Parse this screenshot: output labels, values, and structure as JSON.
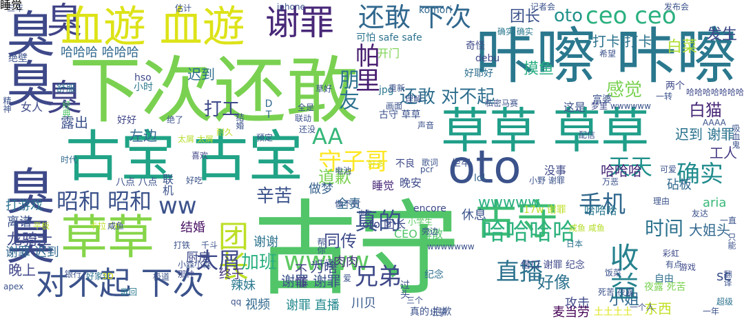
{
  "cloud": {
    "words": [
      {
        "text": "古守",
        "color": "#52c569"
      },
      {
        "text": "下次还敢",
        "color": "#7ad151"
      },
      {
        "text": "咔嚓 咔嚓",
        "color": "#2a788e"
      },
      {
        "text": "草草 草草",
        "color": "#1f9e89"
      },
      {
        "text": "古宝 古宝",
        "color": "#20a386"
      },
      {
        "text": "臭臭 臭臭",
        "color": "#3e4989"
      },
      {
        "text": "臭 臭",
        "color": "#414487"
      },
      {
        "text": "草草",
        "color": "#86d549"
      },
      {
        "text": "血遊 血遊",
        "color": "#dde318"
      },
      {
        "text": "oto",
        "color": "#3b528b"
      },
      {
        "text": "谢罪",
        "color": "#482878"
      },
      {
        "text": "对不起 下次",
        "color": "#3b528b"
      },
      {
        "text": "还敢 下次",
        "color": "#31688e"
      },
      {
        "text": "ceo ceo",
        "color": "#2ab07f"
      },
      {
        "text": "古守",
        "color": "#3dbc74"
      },
      {
        "text": "团长",
        "color": "#bddf26"
      },
      {
        "text": "收益",
        "color": "#26828e"
      },
      {
        "text": "直播",
        "color": "#2c728e"
      },
      {
        "text": "昭和 昭和",
        "color": "#3b528b"
      },
      {
        "text": "ww",
        "color": "#3b528b"
      },
      {
        "text": "守子哥",
        "color": "#fde725"
      },
      {
        "text": "太屑",
        "color": "#3e4989"
      },
      {
        "text": "手机",
        "color": "#31688e"
      },
      {
        "text": "确实",
        "color": "#228c8d"
      },
      {
        "text": "天天",
        "color": "#21918c"
      },
      {
        "text": "哈哈哈哈",
        "color": "#2db27d"
      },
      {
        "text": "wwww",
        "color": "#5ec962"
      },
      {
        "text": "兄弟",
        "color": "#3e4989"
      },
      {
        "text": "真的",
        "color": "#3b528b"
      },
      {
        "text": "AA",
        "color": "#35b779"
      },
      {
        "text": "哈哈哈 哈哈哈",
        "color": "#31688e"
      },
      {
        "text": "白猫",
        "color": "#482878"
      },
      {
        "text": "朋友",
        "color": "#2c728e"
      },
      {
        "text": "帕里",
        "color": "#481f70"
      },
      {
        "text": "还敢 对不起",
        "color": "#2e6e8e"
      },
      {
        "text": "感觉",
        "color": "#7ad151"
      },
      {
        "text": "打工",
        "color": "#3e4989"
      },
      {
        "text": "辛苦",
        "color": "#3b528b"
      },
      {
        "text": "道歉",
        "color": "#7ad151"
      },
      {
        "text": "时间",
        "color": "#2c728e"
      },
      {
        "text": "好像",
        "color": "#2c728e"
      },
      {
        "text": "同传",
        "color": "#3e4989"
      },
      {
        "text": "谢罪 谢罪",
        "color": "#3b528b"
      },
      {
        "text": "加班",
        "color": "#2ab07f"
      },
      {
        "text": "结婚",
        "color": "#471063"
      },
      {
        "text": "wwwww",
        "color": "#29af7f"
      },
      {
        "text": "迟到",
        "color": "#2e6e8e"
      },
      {
        "text": "团长",
        "color": "#3b528b"
      },
      {
        "text": "oto",
        "color": "#21918c"
      },
      {
        "text": "发生",
        "color": "#3e4989"
      },
      {
        "text": "白菜",
        "color": "#addc30"
      },
      {
        "text": "打卡 打卡",
        "color": "#2c728e"
      },
      {
        "text": "摸鱼",
        "color": "#27ad81"
      },
      {
        "text": "露出",
        "color": "#3b528b"
      },
      {
        "text": "左边",
        "color": "#31688e"
      },
      {
        "text": "迟到 谢罪",
        "color": "#2c728e"
      },
      {
        "text": "工人",
        "color": "#443983"
      },
      {
        "text": "哈哈哈",
        "color": "#482878"
      },
      {
        "text": "砧板",
        "color": "#31688e"
      },
      {
        "text": "aria",
        "color": "#37b878"
      },
      {
        "text": "全责",
        "color": "#31688e"
      },
      {
        "text": "oto 团长",
        "color": "#3e4989"
      },
      {
        "text": "大姐头",
        "color": "#31688e"
      },
      {
        "text": "龙骑士",
        "color": "#3e4989"
      },
      {
        "text": "谢谢",
        "color": "#2c728e"
      },
      {
        "text": "谢罪 迟到",
        "color": "#31688e"
      },
      {
        "text": "晚上",
        "color": "#404688"
      },
      {
        "text": "厨房",
        "color": "#3e4989"
      },
      {
        "text": "终于",
        "color": "#463480"
      },
      {
        "text": "辣妹",
        "color": "#2a788e"
      },
      {
        "text": "肉肉",
        "color": "#46327e"
      },
      {
        "text": "为啥",
        "color": "#3e4989"
      },
      {
        "text": "不懂",
        "color": "#433e85"
      },
      {
        "text": "小姐",
        "color": "#31688e"
      },
      {
        "text": "sc",
        "color": "#3b528b"
      },
      {
        "text": "东西",
        "color": "#c2df23"
      },
      {
        "text": "攻击",
        "color": "#3e4989"
      },
      {
        "text": "麦当劳",
        "color": "#440154"
      },
      {
        "text": "谢罪 直播",
        "color": "#23898e"
      },
      {
        "text": "视频",
        "color": "#31688e"
      },
      {
        "text": "川贝",
        "color": "#38598c"
      },
      {
        "text": "离谱",
        "color": "#3b528b"
      },
      {
        "text": "打游戏",
        "color": "#2c728e"
      },
      {
        "text": "晚安",
        "color": "#3e4989"
      },
      {
        "text": "休息",
        "color": "#3b528b"
      },
      {
        "text": "做梦",
        "color": "#35608d"
      },
      {
        "text": "没事",
        "color": "#3e4989"
      },
      {
        "text": "睡觉",
        "color": "#482878"
      },
      {
        "text": "哈哈哈",
        "color": "#2a788e"
      },
      {
        "text": "CEO 解散",
        "color": "#52c569"
      },
      {
        "text": "encore",
        "color": "#3e4989"
      },
      {
        "text": "lol",
        "color": "#33638d"
      },
      {
        "text": "小时",
        "color": "#2a788e"
      },
      {
        "text": "女人",
        "color": "#3e4989"
      },
      {
        "text": "舒服",
        "color": "#2e6e8e"
      },
      {
        "text": "绝壁",
        "color": "#3b528b"
      },
      {
        "text": "好耶好",
        "color": "#2e6e8e"
      },
      {
        "text": "这是",
        "color": "#3b528b"
      },
      {
        "text": "两个",
        "color": "#3e4989"
      },
      {
        "text": "可怕 safe safe",
        "color": "#2c728e"
      },
      {
        "text": "开门",
        "color": "#7ad151"
      },
      {
        "text": "komori",
        "color": "#31688e"
      },
      {
        "text": "奇怪",
        "color": "#3e4989"
      },
      {
        "text": "debu",
        "color": "#3e4989"
      },
      {
        "text": "确实 确实",
        "color": "#2a788e"
      },
      {
        "text": "希望",
        "color": "#3b528b"
      },
      {
        "text": "DT",
        "color": "#31688e"
      },
      {
        "text": "jpg",
        "color": "#2a788e"
      },
      {
        "text": "hso",
        "color": "#3e4989"
      },
      {
        "text": "古守 草草",
        "color": "#3b528b"
      },
      {
        "text": "好好",
        "color": "#404688"
      },
      {
        "text": "八点 八点",
        "color": "#3b528b"
      },
      {
        "text": "时代",
        "color": "#31688e"
      },
      {
        "text": "喜欢",
        "color": "#414487"
      },
      {
        "text": "银行",
        "color": "#3b528b"
      },
      {
        "text": "好家伙",
        "color": "#2c728e"
      },
      {
        "text": "极道",
        "color": "#3b528b"
      },
      {
        "text": "那种",
        "color": "#3e4989"
      },
      {
        "text": "歌回",
        "color": "#2a788e"
      },
      {
        "text": "apex",
        "color": "#3b528b"
      },
      {
        "text": "qq",
        "color": "#3b528b"
      },
      {
        "text": "过头",
        "color": "#3b528b"
      },
      {
        "text": "纪念",
        "color": "#2e6e8e"
      },
      {
        "text": "借口 谢罪 纪念",
        "color": "#3e4989"
      },
      {
        "text": "超级",
        "color": "#2c728e"
      },
      {
        "text": "一年",
        "color": "#3b528b"
      },
      {
        "text": "真的 抱歉",
        "color": "#3b528b"
      },
      {
        "text": "日本",
        "color": "#2c728e"
      },
      {
        "text": "游戏",
        "color": "#3e4989"
      },
      {
        "text": "自由",
        "color": "#2e6e8e"
      },
      {
        "text": "理由",
        "color": "#3b528b"
      },
      {
        "text": "夜露 死苦",
        "color": "#7ad151"
      },
      {
        "text": "小野 谢罪",
        "color": "#3b528b"
      },
      {
        "text": "小学生",
        "color": "#5ec962"
      },
      {
        "text": "17w 谢罪",
        "color": "#bddf26"
      },
      {
        "text": "咸鱼 咸鱼",
        "color": "#b5de2b"
      },
      {
        "text": "不良",
        "color": "#3e4989"
      },
      {
        "text": "坐牢",
        "color": "#3b528b"
      },
      {
        "text": "富婆",
        "color": "#3b528b"
      },
      {
        "text": "配信",
        "color": "#3b528b"
      },
      {
        "text": "记者会",
        "color": "#3b528b"
      },
      {
        "text": "发布会",
        "color": "#3b528b"
      },
      {
        "text": "三年",
        "color": "#3b528b"
      },
      {
        "text": "估计",
        "color": "#3b528b"
      },
      {
        "text": "iphone",
        "color": "#3b528b"
      },
      {
        "text": "哈哈哈哈哈哈哈",
        "color": "#3e4989"
      },
      {
        "text": "wwwwww",
        "color": "#3b528b"
      },
      {
        "text": "梦里",
        "color": "#3e4989"
      },
      {
        "text": "私密马赛",
        "color": "#3b528b"
      },
      {
        "text": "AAAA",
        "color": "#3b528b"
      },
      {
        "text": "中文",
        "color": "#3b528b"
      },
      {
        "text": "友达",
        "color": "#3b528b"
      },
      {
        "text": "一直",
        "color": "#3b528b"
      },
      {
        "text": "彩虹",
        "color": "#3e4989"
      },
      {
        "text": "有点",
        "color": "#3b528b"
      },
      {
        "text": "可爱",
        "color": "#3b528b"
      },
      {
        "text": "死苦 夜露",
        "color": "#3b528b"
      },
      {
        "text": "声音",
        "color": "#3b528b"
      },
      {
        "text": "土土土土",
        "color": "#dde318"
      },
      {
        "text": "三个",
        "color": "#3b528b"
      },
      {
        "text": "卡拉 OK",
        "color": "#bddf26"
      },
      {
        "text": "平板",
        "color": "#bddf26"
      },
      {
        "text": "咸鱼",
        "color": "#3b528b"
      },
      {
        "text": "3D",
        "color": "#dde318"
      },
      {
        "text": "千斗",
        "color": "#3b528b"
      },
      {
        "text": "wwwwwww",
        "color": "#3b528b"
      },
      {
        "text": "预定",
        "color": "#3b528b"
      },
      {
        "text": "电池",
        "color": "#3b528b"
      },
      {
        "text": "好多",
        "color": "#dde318"
      },
      {
        "text": "全是",
        "color": "#3b528b"
      },
      {
        "text": "联动",
        "color": "#3b528b"
      },
      {
        "text": "一转",
        "color": "#3b528b"
      },
      {
        "text": "草好",
        "color": "#3b528b"
      },
      {
        "text": "耐久",
        "color": "#bddf26"
      },
      {
        "text": "还没",
        "color": "#3b528b"
      },
      {
        "text": "牛逼",
        "color": "#3b528b"
      },
      {
        "text": "歌词",
        "color": "#3b528b"
      },
      {
        "text": "帮你",
        "color": "#3b528b"
      },
      {
        "text": "精神",
        "color": "#3b528b"
      },
      {
        "text": "经典",
        "color": "#52c569"
      },
      {
        "text": "联机",
        "color": "#3b528b"
      },
      {
        "text": "太屑 太屑",
        "color": "#b5de2b"
      },
      {
        "text": "绝了",
        "color": "#3b528b"
      },
      {
        "text": "好吃",
        "color": "#3b528b"
      },
      {
        "text": "万恶",
        "color": "#3b528b"
      },
      {
        "text": "结婚",
        "color": "#3b528b"
      },
      {
        "text": "pcr",
        "color": "#3b528b"
      },
      {
        "text": "饭菜",
        "color": "#3b528b"
      },
      {
        "text": "一个人",
        "color": "#3b528b"
      },
      {
        "text": "只能",
        "color": "#3b528b"
      },
      {
        "text": "翻译",
        "color": "#3b528b"
      },
      {
        "text": "吸血鬼",
        "color": "#3b528b"
      },
      {
        "text": "小森小森",
        "color": "#3b528b"
      },
      {
        "text": "打铁",
        "color": "#3b528b"
      },
      {
        "text": "旁边",
        "color": "#3b528b"
      },
      {
        "text": "理解",
        "color": "#3b528b"
      },
      {
        "text": "重新",
        "color": "#3b528b"
      },
      {
        "text": "画面",
        "color": "#3b528b"
      },
      {
        "text": "爱",
        "color": "#3b528b"
      },
      {
        "text": "做不到",
        "color": "#3b528b"
      },
      {
        "text": "坛子",
        "color": "#3b528b"
      },
      {
        "text": "睡觉",
        "color": "#3b528b"
      }
    ]
  }
}
